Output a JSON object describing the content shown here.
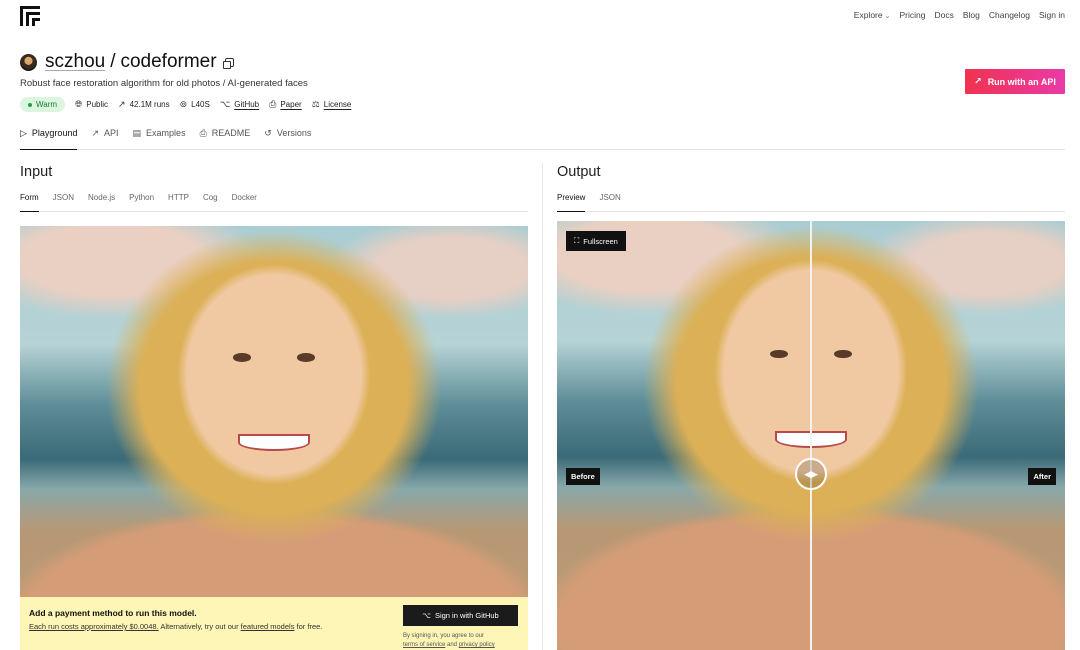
{
  "nav": {
    "links": [
      "Explore",
      "Pricing",
      "Docs",
      "Blog",
      "Changelog",
      "Sign in"
    ]
  },
  "model": {
    "owner": "sczhou",
    "separator": "/",
    "name": "codeformer",
    "description": "Robust face restoration algorithm for old photos / AI-generated faces",
    "status": "Warm",
    "visibility": "Public",
    "runs": "42.1M runs",
    "hardware": "L40S",
    "github": "GitHub",
    "paper": "Paper",
    "license": "License"
  },
  "api_button": "Run with an API",
  "tabs": [
    "Playground",
    "API",
    "Examples",
    "README",
    "Versions"
  ],
  "input": {
    "title": "Input",
    "subtabs": [
      "Form",
      "JSON",
      "Node.js",
      "Python",
      "HTTP",
      "Cog",
      "Docker"
    ]
  },
  "output": {
    "title": "Output",
    "subtabs": [
      "Preview",
      "JSON"
    ],
    "fullscreen": "Fullscreen",
    "before": "Before",
    "after": "After"
  },
  "banner": {
    "title": "Add a payment method to run this model.",
    "cost_text": "Each run costs approximately $0.0048.",
    "alt_prefix": " Alternatively, try out our ",
    "featured": "featured models",
    "alt_suffix": " for free.",
    "github_button": "Sign in with GitHub",
    "fine_prefix": "By signing in, you agree to our",
    "terms": "terms of service",
    "fine_and": " and ",
    "privacy": "privacy policy"
  },
  "colors": {
    "api_gradient_start": "#f0324f",
    "api_gradient_end": "#ea3aa8",
    "warm_bg": "#dcf5df",
    "banner_bg": "#fef6b6"
  }
}
